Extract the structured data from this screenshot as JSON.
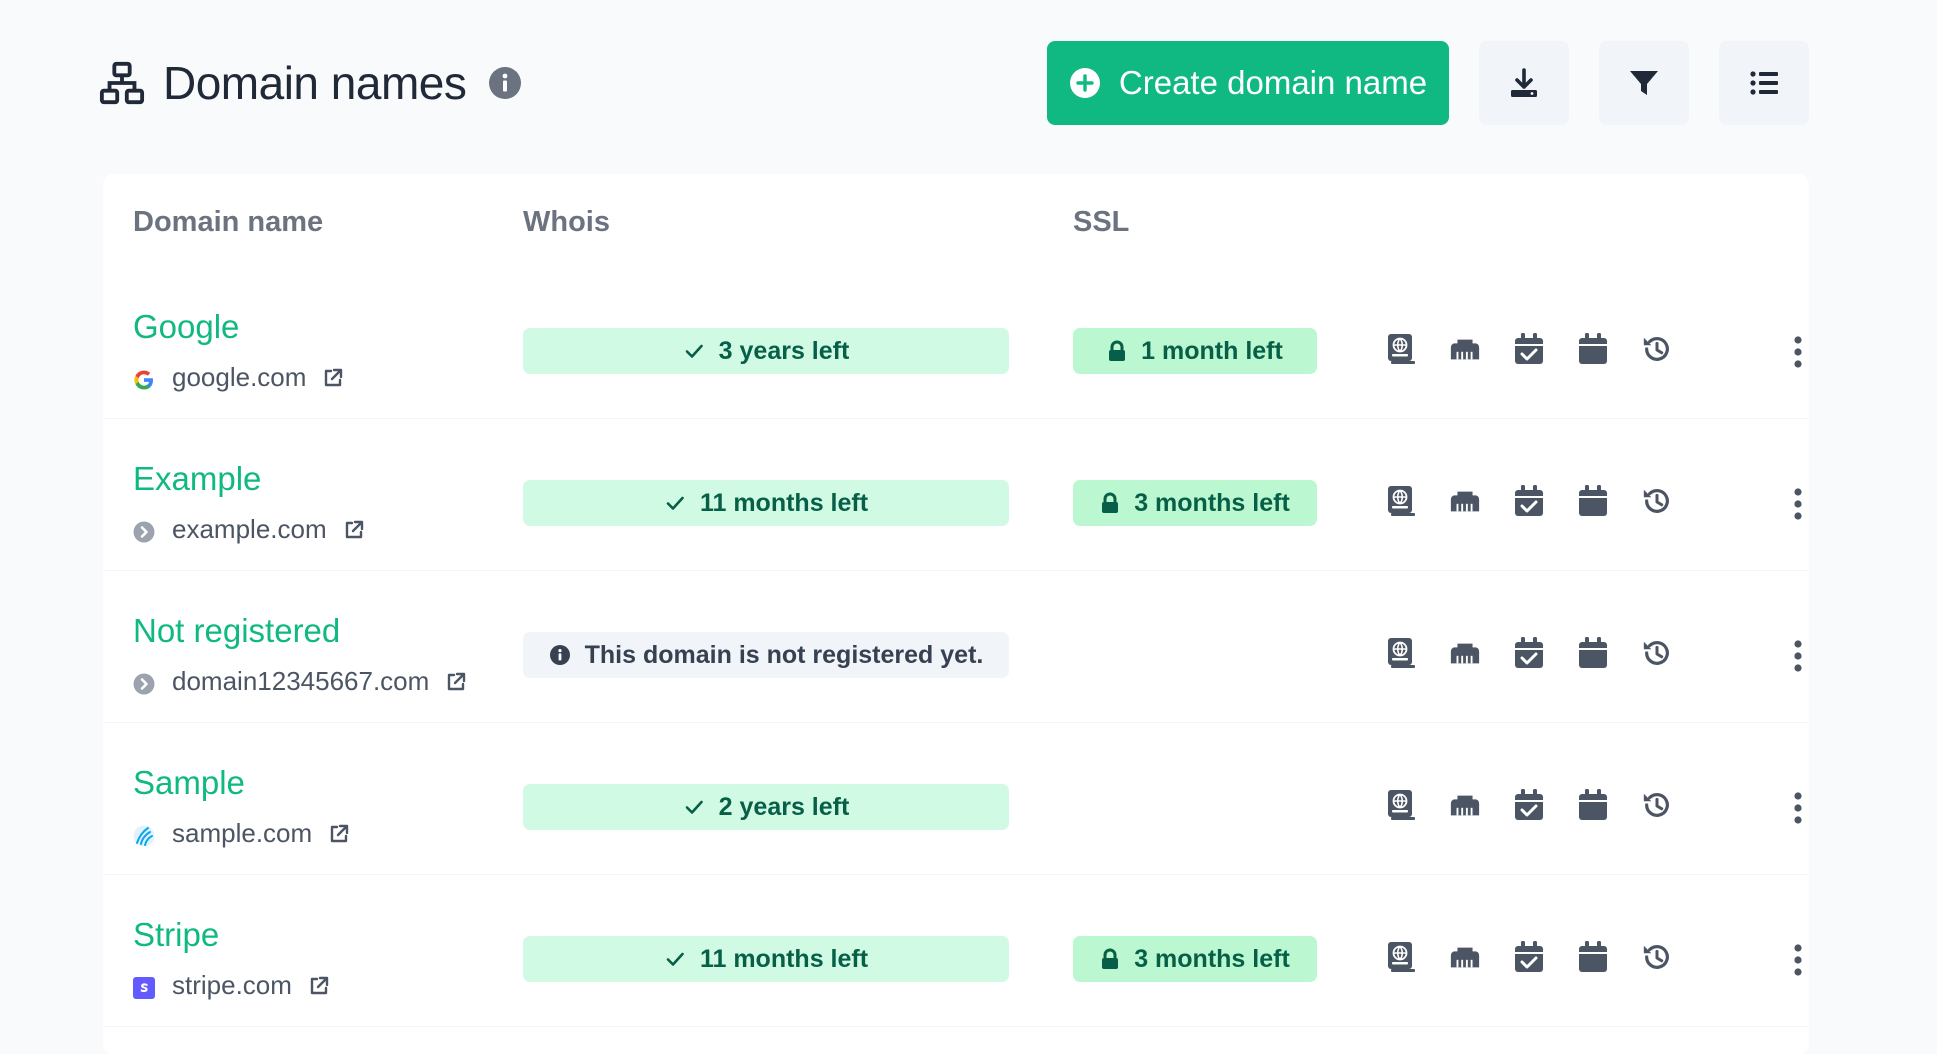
{
  "header": {
    "title": "Domain names",
    "create_label": "Create domain name",
    "title_icon": "sitemap-icon",
    "info_icon": "info-icon",
    "buttons": [
      "download-icon",
      "filter-icon",
      "list-icon"
    ]
  },
  "table": {
    "headers": {
      "domain": "Domain name",
      "whois": "Whois",
      "ssl": "SSL"
    },
    "rows": [
      {
        "name": "Google",
        "url": "google.com",
        "favicon": "google-icon",
        "whois": "3 years left",
        "whois_state": "ok",
        "ssl": "1 month left"
      },
      {
        "name": "Example",
        "url": "example.com",
        "favicon": "chevron-circle-icon",
        "whois": "11 months left",
        "whois_state": "ok",
        "ssl": "3 months left"
      },
      {
        "name": "Not registered",
        "url": "domain12345667.com",
        "favicon": "chevron-circle-icon",
        "whois": "This domain is not registered yet.",
        "whois_state": "unregistered",
        "ssl": null
      },
      {
        "name": "Sample",
        "url": "sample.com",
        "favicon": "sample-logo-icon",
        "whois": "2 years left",
        "whois_state": "ok",
        "ssl": null
      },
      {
        "name": "Stripe",
        "url": "stripe.com",
        "favicon": "stripe-icon",
        "whois": "11 months left",
        "whois_state": "ok",
        "ssl": "3 months left"
      }
    ],
    "row_actions": [
      "address-book-icon",
      "ethernet-icon",
      "calendar-check-icon",
      "calendar-icon",
      "history-icon"
    ]
  },
  "colors": {
    "accent": "#10b981",
    "pill_green": "#d1fae5",
    "pill_ssl": "#bbf7d0",
    "icon_gray": "#4b5563"
  }
}
